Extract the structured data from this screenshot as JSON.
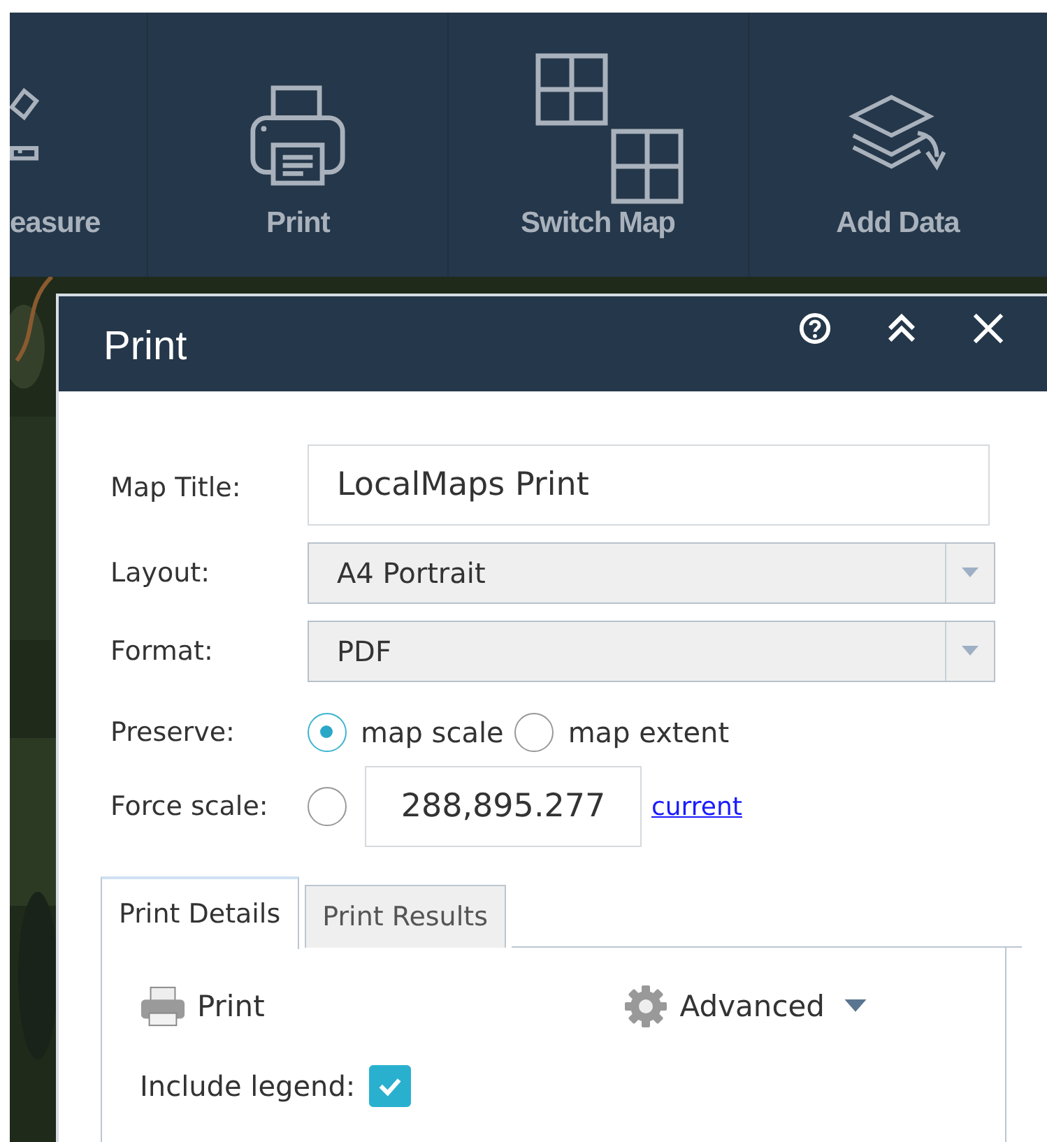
{
  "toolbar": [
    {
      "label": "easure"
    },
    {
      "label": "Print"
    },
    {
      "label": "Switch Map"
    },
    {
      "label": "Add Data"
    }
  ],
  "panel": {
    "title": "Print",
    "form": {
      "map_title": {
        "label": "Map Title:",
        "value": "LocalMaps Print"
      },
      "layout": {
        "label": "Layout:",
        "value": "A4 Portrait"
      },
      "format": {
        "label": "Format:",
        "value": "PDF"
      },
      "preserve": {
        "label": "Preserve:",
        "options": [
          {
            "label": "map scale",
            "selected": true
          },
          {
            "label": "map extent",
            "selected": false
          }
        ]
      },
      "force_scale": {
        "label": "Force scale:",
        "checked": false,
        "value": "288,895.277",
        "link": "current"
      }
    },
    "tabs": [
      {
        "label": "Print Details",
        "selected": true
      },
      {
        "label": "Print Results",
        "selected": false
      }
    ],
    "details": {
      "print_button": "Print",
      "advanced": "Advanced",
      "include_legend": {
        "label": "Include legend:",
        "checked": true
      }
    }
  }
}
